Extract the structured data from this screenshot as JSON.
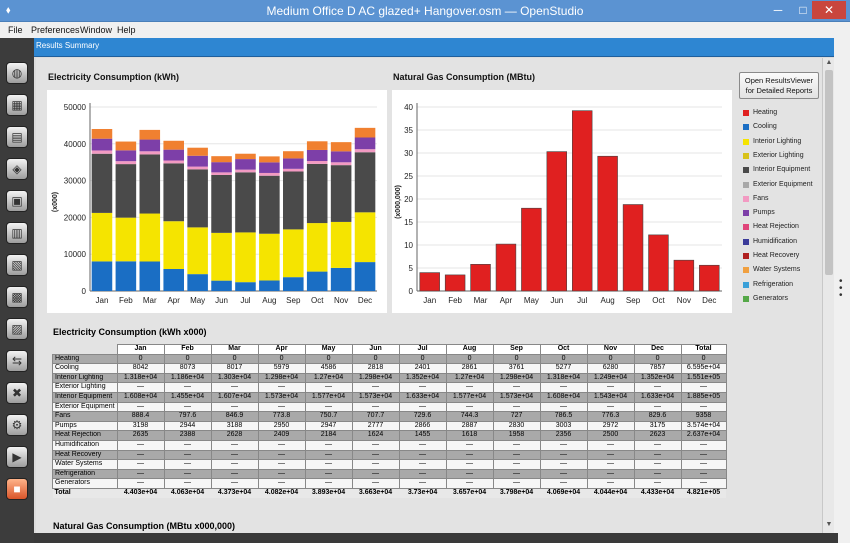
{
  "window": {
    "title": "Medium Office D AC glazed+ Hangover.osm — OpenStudio",
    "minimize": "─",
    "maximize": "□",
    "close": "✕"
  },
  "menu": [
    "File",
    "Preferences",
    "Window",
    "Help"
  ],
  "tab": "Results Summary",
  "sidebar_icons": [
    "site-icon",
    "schedules-icon",
    "constructions-icon",
    "loads-icon",
    "space-types-icon",
    "facility-icon",
    "thermal-zones-icon",
    "hvac-systems-icon",
    "building-summary-icon",
    "measures-icon",
    "simulation-settings-icon",
    "scripts-icon",
    "run-icon",
    "results-icon"
  ],
  "results_viewer_button": "Open ResultsViewer for Detailed Reports",
  "legend": [
    {
      "name": "Heating",
      "color": "#e02020"
    },
    {
      "name": "Cooling",
      "color": "#1a6ec4"
    },
    {
      "name": "Interior Lighting",
      "color": "#f5e400"
    },
    {
      "name": "Exterior Lighting",
      "color": "#d8c21a"
    },
    {
      "name": "Interior Equipment",
      "color": "#4a4a4a"
    },
    {
      "name": "Exterior Equipment",
      "color": "#a8a8a8"
    },
    {
      "name": "Fans",
      "color": "#f29ac2"
    },
    {
      "name": "Pumps",
      "color": "#7d3fa8"
    },
    {
      "name": "Heat Rejection",
      "color": "#e0457a"
    },
    {
      "name": "Humidification",
      "color": "#3b3b9a"
    },
    {
      "name": "Heat Recovery",
      "color": "#b02020"
    },
    {
      "name": "Water Systems",
      "color": "#f0a040"
    },
    {
      "name": "Refrigeration",
      "color": "#3aa0d8"
    },
    {
      "name": "Generators",
      "color": "#55a848"
    }
  ],
  "chart_data": [
    {
      "type": "bar",
      "stacked": true,
      "title": "Electricity Consumption (kWh)",
      "ylabel": "(x000)",
      "ylim": [
        0,
        50000
      ],
      "yticks": [
        0,
        10000,
        20000,
        30000,
        40000,
        50000
      ],
      "categories": [
        "Jan",
        "Feb",
        "Mar",
        "Apr",
        "May",
        "Jun",
        "Jul",
        "Aug",
        "Sep",
        "Oct",
        "Nov",
        "Dec"
      ],
      "series": [
        {
          "name": "Cooling",
          "color": "#1a6ec4",
          "values": [
            8042,
            8073,
            8017,
            5979,
            4586,
            2818,
            2401,
            2861,
            3761,
            5277,
            6280,
            7857
          ]
        },
        {
          "name": "Interior Lighting",
          "color": "#f5e400",
          "values": [
            13180,
            11860,
            13030,
            12980,
            12700,
            12980,
            13520,
            12700,
            12980,
            13180,
            12490,
            13520
          ]
        },
        {
          "name": "Interior Equipment",
          "color": "#4a4a4a",
          "values": [
            16080,
            14550,
            16070,
            15730,
            15770,
            15730,
            16330,
            15770,
            15730,
            16080,
            15430,
            16330
          ]
        },
        {
          "name": "Fans",
          "color": "#f29ac2",
          "values": [
            888.4,
            797.6,
            846.9,
            773.8,
            750.7,
            707.7,
            729.6,
            744.3,
            727,
            786.5,
            776.3,
            829.6
          ]
        },
        {
          "name": "Pumps",
          "color": "#7d3fa8",
          "values": [
            3198,
            2944,
            3188,
            2950,
            2947,
            2777,
            2866,
            2887,
            2830,
            3003,
            2972,
            3175
          ]
        },
        {
          "name": "Heat Rejection",
          "color": "#f08030",
          "values": [
            2635,
            2388,
            2628,
            2409,
            2184,
            1624,
            1455,
            1618,
            1958,
            2356,
            2500,
            2623
          ]
        }
      ]
    },
    {
      "type": "bar",
      "title": "Natural Gas Consumption (MBtu)",
      "ylabel": "(x000,000)",
      "ylim": [
        0,
        40
      ],
      "yticks": [
        0,
        5,
        10,
        15,
        20,
        25,
        30,
        35,
        40
      ],
      "categories": [
        "Jan",
        "Feb",
        "Mar",
        "Apr",
        "May",
        "Jun",
        "Jul",
        "Aug",
        "Sep",
        "Oct",
        "Nov",
        "Dec"
      ],
      "series": [
        {
          "name": "Heating",
          "color": "#e02020",
          "values": [
            4,
            3.5,
            5.8,
            10.2,
            18,
            30.3,
            39.2,
            29.3,
            18.8,
            12.2,
            6.7,
            5.6
          ]
        }
      ]
    }
  ],
  "elec_table": {
    "title": "Electricity Consumption (kWh x000)",
    "columns": [
      "Jan",
      "Feb",
      "Mar",
      "Apr",
      "May",
      "Jun",
      "Jul",
      "Aug",
      "Sep",
      "Oct",
      "Nov",
      "Dec",
      "Total"
    ],
    "rows": [
      {
        "label": "Heating",
        "values": [
          "0",
          "0",
          "0",
          "0",
          "0",
          "0",
          "0",
          "0",
          "0",
          "0",
          "0",
          "0",
          "0"
        ]
      },
      {
        "label": "Cooling",
        "values": [
          "8042",
          "8073",
          "8017",
          "5979",
          "4586",
          "2818",
          "2401",
          "2861",
          "3761",
          "5277",
          "6280",
          "7857",
          "6.595e+04"
        ]
      },
      {
        "label": "Interior Lighting",
        "values": [
          "1.318e+04",
          "1.186e+04",
          "1.303e+04",
          "1.298e+04",
          "1.27e+04",
          "1.298e+04",
          "1.352e+04",
          "1.27e+04",
          "1.298e+04",
          "1.318e+04",
          "1.249e+04",
          "1.352e+04",
          "1.551e+05"
        ]
      },
      {
        "label": "Exterior Lighting",
        "values": [
          "—",
          "—",
          "—",
          "—",
          "—",
          "—",
          "—",
          "—",
          "—",
          "—",
          "—",
          "—",
          "—"
        ]
      },
      {
        "label": "Interior Equipment",
        "values": [
          "1.608e+04",
          "1.455e+04",
          "1.607e+04",
          "1.573e+04",
          "1.577e+04",
          "1.573e+04",
          "1.633e+04",
          "1.577e+04",
          "1.573e+04",
          "1.608e+04",
          "1.543e+04",
          "1.633e+04",
          "1.885e+05"
        ]
      },
      {
        "label": "Exterior Equipment",
        "values": [
          "—",
          "—",
          "—",
          "—",
          "—",
          "—",
          "—",
          "—",
          "—",
          "—",
          "—",
          "—",
          "—"
        ]
      },
      {
        "label": "Fans",
        "values": [
          "888.4",
          "797.6",
          "846.9",
          "773.8",
          "750.7",
          "707.7",
          "729.6",
          "744.3",
          "727",
          "786.5",
          "776.3",
          "829.6",
          "9358"
        ]
      },
      {
        "label": "Pumps",
        "values": [
          "3198",
          "2944",
          "3188",
          "2950",
          "2947",
          "2777",
          "2866",
          "2887",
          "2830",
          "3003",
          "2972",
          "3175",
          "3.574e+04"
        ]
      },
      {
        "label": "Heat Rejection",
        "values": [
          "2635",
          "2388",
          "2628",
          "2409",
          "2184",
          "1624",
          "1455",
          "1618",
          "1958",
          "2356",
          "2500",
          "2623",
          "2.637e+04"
        ]
      },
      {
        "label": "Humidification",
        "values": [
          "—",
          "—",
          "—",
          "—",
          "—",
          "—",
          "—",
          "—",
          "—",
          "—",
          "—",
          "—",
          "—"
        ]
      },
      {
        "label": "Heat Recovery",
        "values": [
          "—",
          "—",
          "—",
          "—",
          "—",
          "—",
          "—",
          "—",
          "—",
          "—",
          "—",
          "—",
          "—"
        ]
      },
      {
        "label": "Water Systems",
        "values": [
          "—",
          "—",
          "—",
          "—",
          "—",
          "—",
          "—",
          "—",
          "—",
          "—",
          "—",
          "—",
          "—"
        ]
      },
      {
        "label": "Refrigeration",
        "values": [
          "—",
          "—",
          "—",
          "—",
          "—",
          "—",
          "—",
          "—",
          "—",
          "—",
          "—",
          "—",
          "—"
        ]
      },
      {
        "label": "Generators",
        "values": [
          "—",
          "—",
          "—",
          "—",
          "—",
          "—",
          "—",
          "—",
          "—",
          "—",
          "—",
          "—",
          "—"
        ]
      }
    ],
    "total": {
      "label": "Total",
      "values": [
        "4.403e+04",
        "4.063e+04",
        "4.373e+04",
        "4.082e+04",
        "3.893e+04",
        "3.663e+04",
        "3.73e+04",
        "3.657e+04",
        "3.798e+04",
        "4.069e+04",
        "4.044e+04",
        "4.433e+04",
        "4.821e+05"
      ]
    }
  },
  "gas_table_title": "Natural Gas Consumption (MBtu x000,000)"
}
